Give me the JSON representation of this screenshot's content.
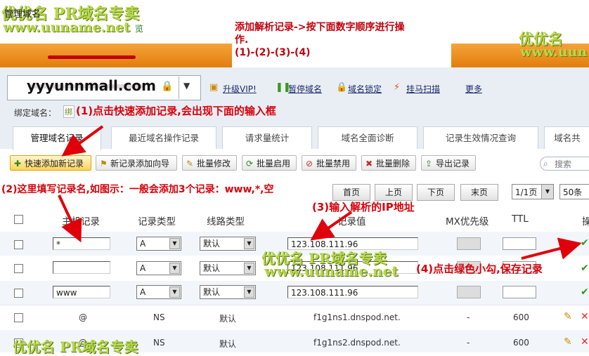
{
  "watermark": {
    "brand": "优优名 PR域名专卖",
    "url": "www.uuname.net",
    "brand_short": "优优名",
    "url_short": "www.uun",
    "left_overlap": "览"
  },
  "instruction": {
    "line1": "添加解析记录->按下面数字顺序进行操",
    "line2": "作.",
    "line3": "(1)-(2)-(3)-(4)"
  },
  "header": {
    "domain_label": "管理域名"
  },
  "domain_box": {
    "value": "yyyunnmall.com",
    "lock_icon": "lock-icon",
    "dropdown_icon": "chevron-down-icon"
  },
  "toolbar": {
    "items": [
      {
        "label": "升级VIP!",
        "icon": "vip-icon"
      },
      {
        "label": "暂停域名",
        "icon": "pause-icon"
      },
      {
        "label": "域名锁定",
        "icon": "lock-icon"
      },
      {
        "label": "挂马扫描",
        "icon": "scan-icon"
      },
      {
        "label": "更多",
        "icon": ""
      }
    ]
  },
  "bind_domain_label": "绑定域名：",
  "bind_chip_text": "绑",
  "annotations": {
    "step1": "(1)点击快速添加记录,会出现下面的输入框",
    "step2": "(2)这里填写记录名,如图示：一般会添加3个记录：www,*,空",
    "step3": "(3)输入解析的IP地址",
    "step4": "(4)点击绿色小勾,保存记录"
  },
  "tabs": [
    "管理域名记录",
    "最近域名操作记录",
    "请求量统计",
    "域名全面诊断",
    "记录生效情况查询",
    "域名共"
  ],
  "actions": [
    {
      "label": "快速添加新记录",
      "icon": "plus-icon"
    },
    {
      "label": "新记录添加向导",
      "icon": "wizard-icon"
    },
    {
      "label": "批量修改",
      "icon": "edit-icon"
    },
    {
      "label": "批量启用",
      "icon": "enable-icon"
    },
    {
      "label": "批量禁用",
      "icon": "disable-icon"
    },
    {
      "label": "批量删除",
      "icon": "delete-icon"
    },
    {
      "label": "导出记录",
      "icon": "export-icon"
    }
  ],
  "search": {
    "placeholder": "搜索"
  },
  "pager": {
    "first": "首页",
    "prev": "上页",
    "next": "下页",
    "last": "末页",
    "page": "1/1页",
    "per_page": "50条"
  },
  "columns": {
    "host": "主机记录",
    "type": "记录类型",
    "line": "线路类型",
    "value": "记录值",
    "mx": "MX优先级",
    "ttl": "TTL",
    "op": "操"
  },
  "edit_rows": [
    {
      "host": "*",
      "type": "A",
      "line": "默认",
      "value": "123.108.111.96"
    },
    {
      "host": "",
      "type": "A",
      "line": "默认",
      "value": "123.108.111.96"
    },
    {
      "host": "www",
      "type": "A",
      "line": "默认",
      "value": "123.108.111.96"
    }
  ],
  "records": [
    {
      "host": "@",
      "type": "NS",
      "line": "默认",
      "value": "f1g1ns1.dnspod.net.",
      "mx": "-",
      "ttl": "600"
    },
    {
      "host": "@",
      "type": "NS",
      "line": "默认",
      "value": "f1g1ns2.dnspod.net.",
      "mx": "-",
      "ttl": "600"
    }
  ],
  "colors": {
    "accent_orange": "#f39a2a",
    "annotation_red": "#d8000a",
    "check_green": "#2a9a1a",
    "watermark_green": "#b8d84a"
  }
}
